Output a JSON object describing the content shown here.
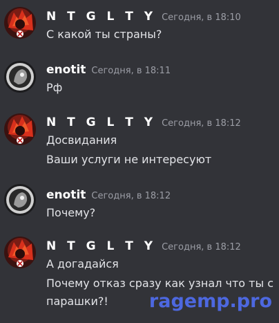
{
  "messages": [
    {
      "username": "N T G L T Y",
      "timestamp": "Сегодня, в 18:10",
      "lines": [
        "С какой ты страны?"
      ]
    },
    {
      "username": "enotit",
      "timestamp": "Сегодня, в 18:11",
      "lines": [
        "Рф"
      ]
    },
    {
      "username": "N T G L T Y",
      "timestamp": "Сегодня, в 18:12",
      "lines": [
        "Досвидания",
        "Ваши услуги не интересуют"
      ]
    },
    {
      "username": "enotit",
      "timestamp": "Сегодня, в 18:12",
      "lines": [
        "Почему?"
      ]
    },
    {
      "username": "N T G L T Y",
      "timestamp": "Сегодня, в 18:12",
      "lines": [
        "А догадайся",
        "Почему отказ сразу как узнал что ты с",
        "парашки?!"
      ]
    }
  ],
  "watermark": "ragemp.pro"
}
